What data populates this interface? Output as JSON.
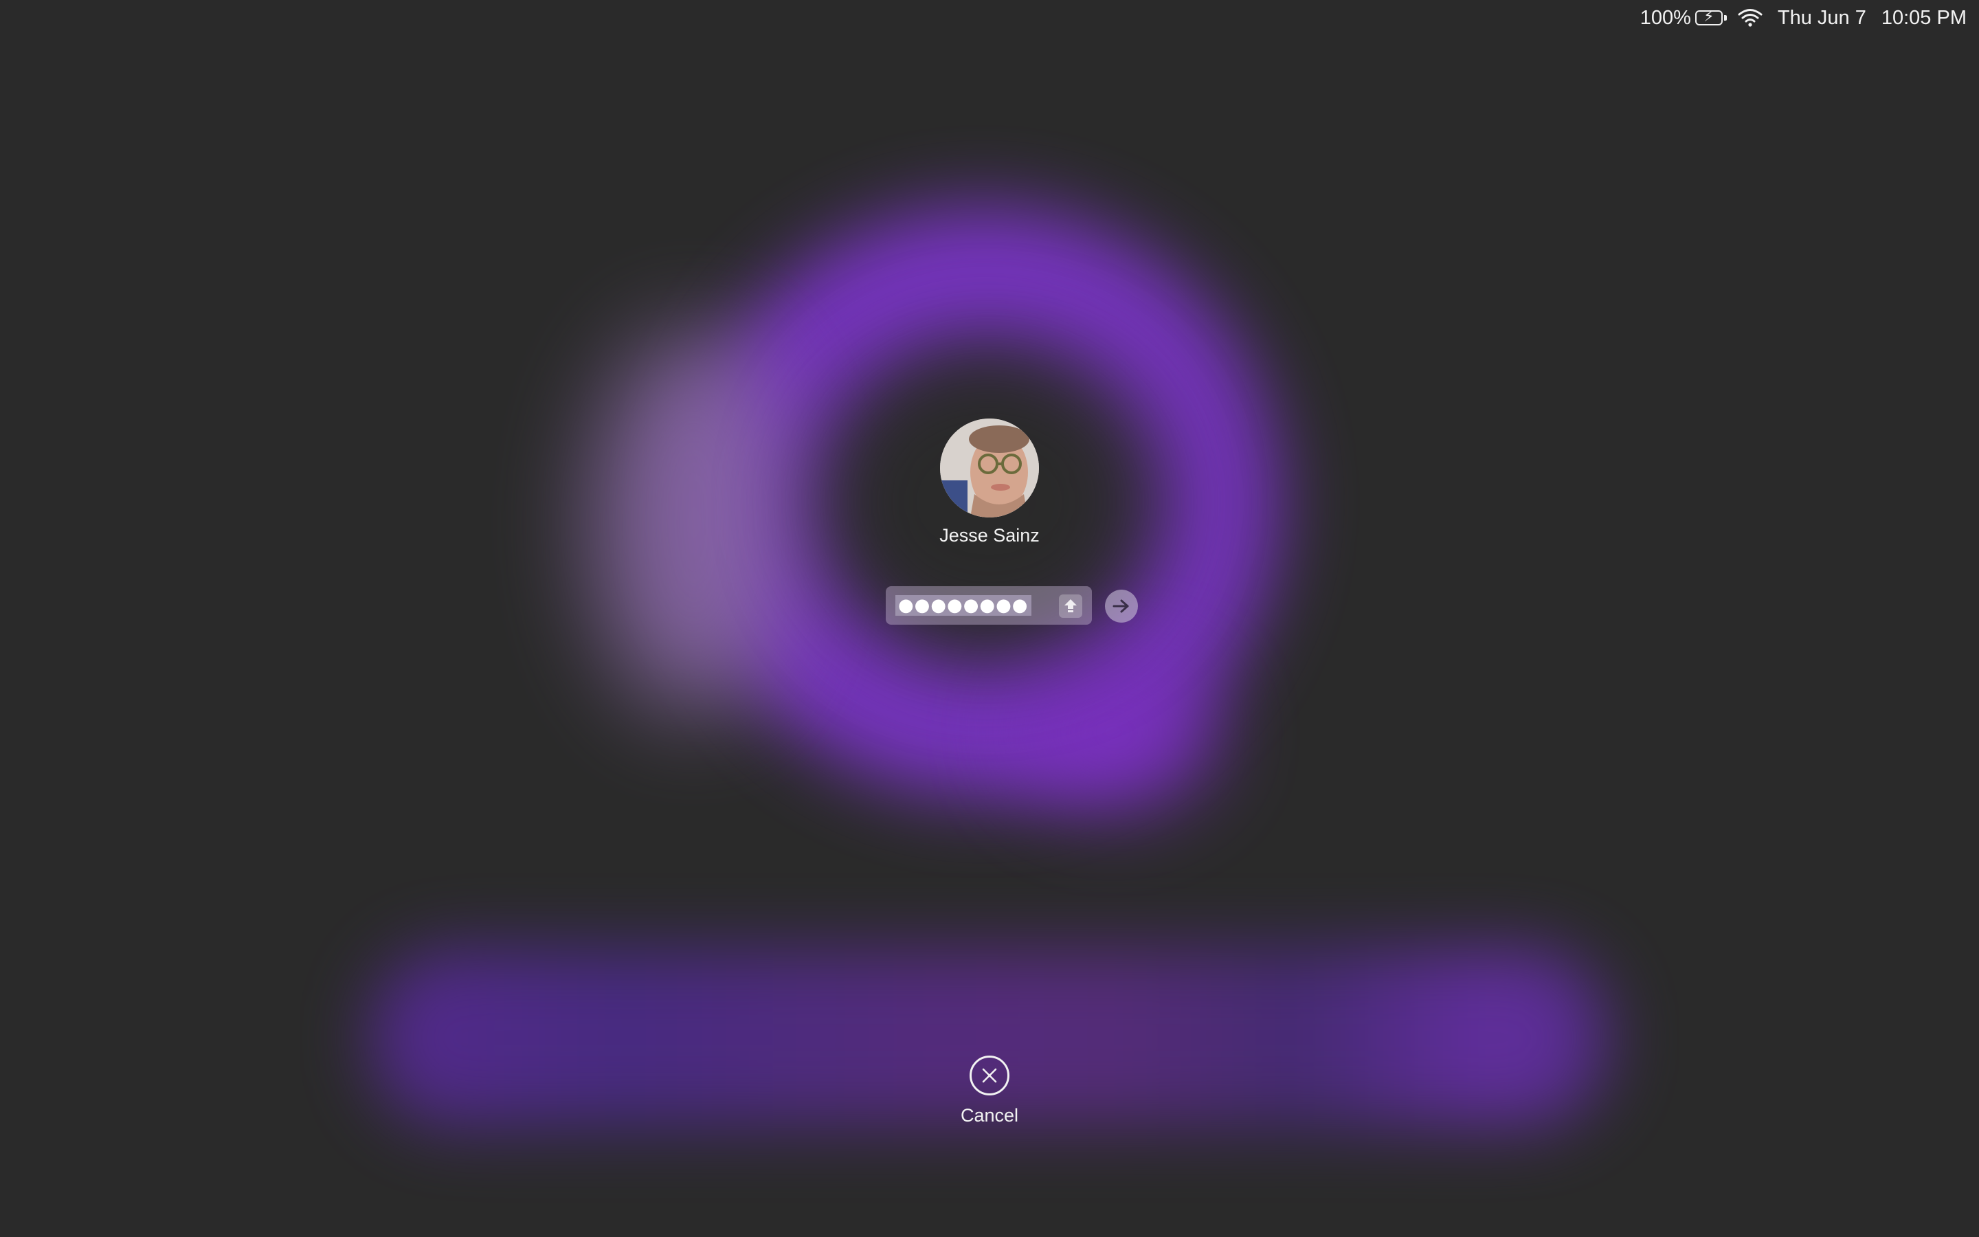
{
  "menubar": {
    "battery_percent": "100%",
    "battery_icon": "battery-charging-icon",
    "wifi_icon": "wifi-icon",
    "date": "Thu Jun 7",
    "time": "10:05 PM"
  },
  "login": {
    "user_name": "Jesse Sainz",
    "avatar_icon": "user-photo",
    "password_masked": "●●●●●●●●",
    "caps_lock_icon": "caps-lock-icon",
    "submit_icon": "arrow-right-icon"
  },
  "cancel": {
    "label": "Cancel",
    "icon": "close-circle-icon"
  },
  "colors": {
    "background": "#2a2a2a",
    "wallpaper_accent": "#7b35c8"
  }
}
